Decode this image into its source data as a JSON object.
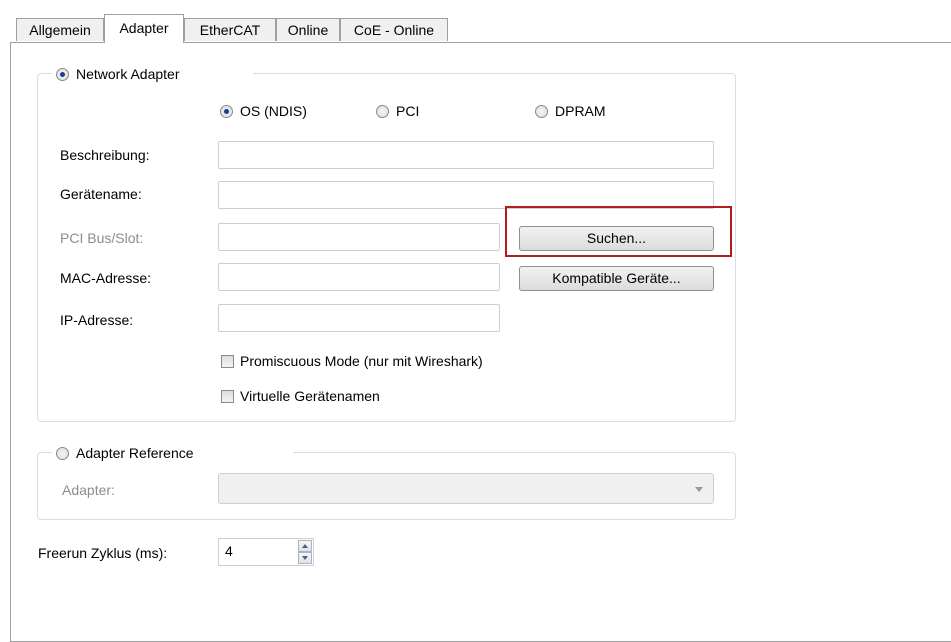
{
  "tabs": [
    {
      "label": "Allgemein"
    },
    {
      "label": "Adapter",
      "active": true
    },
    {
      "label": "EtherCAT"
    },
    {
      "label": "Online"
    },
    {
      "label": "CoE - Online"
    }
  ],
  "network_adapter": {
    "label": "Network Adapter",
    "selected": true,
    "types": [
      {
        "label": "OS (NDIS)",
        "selected": true
      },
      {
        "label": "PCI",
        "selected": false
      },
      {
        "label": "DPRAM",
        "selected": false
      }
    ],
    "beschreibung": {
      "label": "Beschreibung:",
      "value": ""
    },
    "geraetename": {
      "label": "Gerätename:",
      "value": ""
    },
    "pci_bus_slot": {
      "label": "PCI Bus/Slot:",
      "value": "",
      "disabled": true
    },
    "mac_adresse": {
      "label": "MAC-Adresse:",
      "value": ""
    },
    "ip_adresse": {
      "label": "IP-Adresse:",
      "value": ""
    },
    "search_button": "Suchen...",
    "compatible_button": "Kompatible Geräte...",
    "promiscuous": {
      "label": "Promiscuous Mode (nur mit Wireshark)",
      "checked": false
    },
    "virtual_names": {
      "label": "Virtuelle Gerätenamen",
      "checked": false
    }
  },
  "adapter_reference": {
    "label": "Adapter Reference",
    "selected": false,
    "adapter_label": "Adapter:",
    "adapter_value": ""
  },
  "freerun": {
    "label": "Freerun Zyklus (ms):",
    "value": "4"
  },
  "colors": {
    "highlight_border": "#b01e22",
    "radio_dot": "#1b3f8f"
  }
}
